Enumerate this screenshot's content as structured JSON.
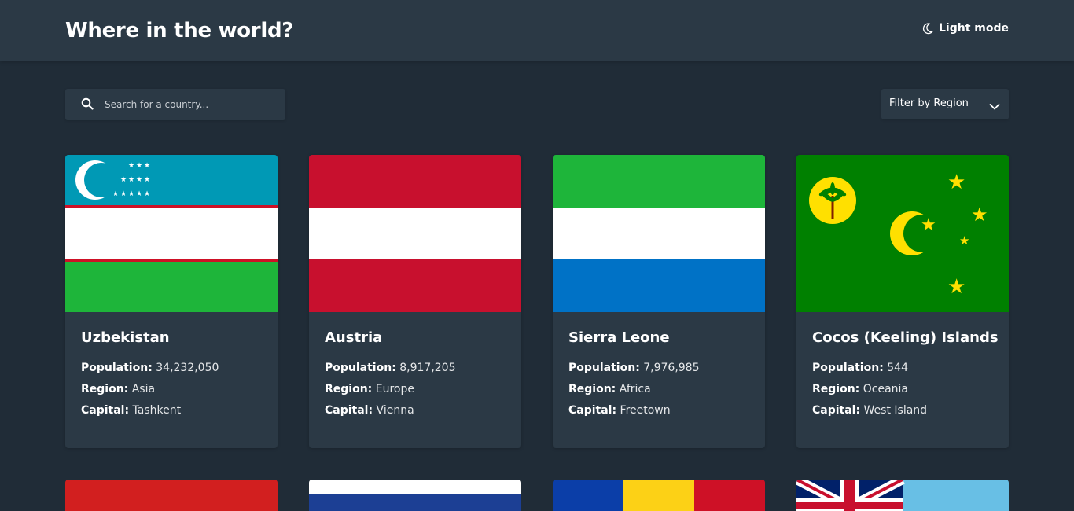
{
  "header": {
    "title": "Where in the world?",
    "theme_toggle_label": "Light mode",
    "theme_icon": "moon-icon"
  },
  "search": {
    "placeholder": "Search for a country...",
    "value": "",
    "icon": "search-icon"
  },
  "filter": {
    "label": "Filter by Region",
    "icon": "chevron-down-icon"
  },
  "labels": {
    "population": "Population:",
    "region": "Region:",
    "capital": "Capital:"
  },
  "countries": [
    {
      "name": "Uzbekistan",
      "population": "34,232,050",
      "region": "Asia",
      "capital": "Tashkent"
    },
    {
      "name": "Austria",
      "population": "8,917,205",
      "region": "Europe",
      "capital": "Vienna"
    },
    {
      "name": "Sierra Leone",
      "population": "7,976,985",
      "region": "Africa",
      "capital": "Freetown"
    },
    {
      "name": "Cocos (Keeling) Islands",
      "population": "544",
      "region": "Oceania",
      "capital": "West Island"
    }
  ],
  "colors": {
    "background": "#202c37",
    "element": "#2b3945",
    "text": "#ffffff"
  }
}
